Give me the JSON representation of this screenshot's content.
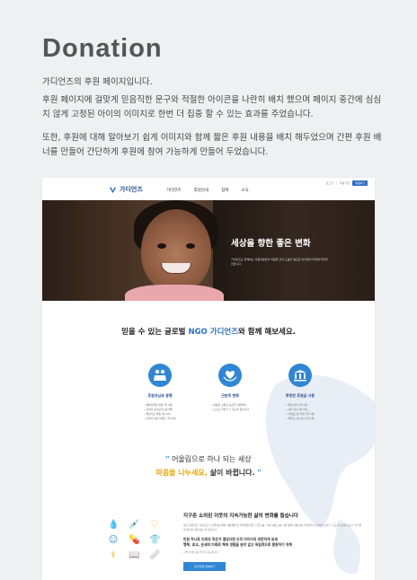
{
  "doc": {
    "title": "Donation",
    "subtitle": "가디언즈의 후원 페이지입니다.",
    "paragraph1": "후원 페이지에 걸맞게 믿음직한 문구와 적절한 아이콘을 나란히 배치 했으며 페이지 중간에 심심치 않게 고정된 아이의 이미지로 한번 더 집중 할 수 있는 효과를 주었습니다.",
    "paragraph2": "또한, 후원에 대해 알아보기 쉽게 이미지와 함께 짧은 후원 내용을 배치 해두었으며 간편 후원 배너를 만들어 간단하게 후원에 참여 가능하게 만들어 두었습니다."
  },
  "site": {
    "util_links": [
      "로그인",
      "회원가입"
    ],
    "donate_button": "후원하기",
    "logo_text": "가디언즈",
    "nav": [
      "가디언즈",
      "후원안내",
      "참여",
      "소식"
    ],
    "hero": {
      "title": "세상을 향한 좋은 변화",
      "text": "가디언즈는 함께하는 후원자분들의 마음을 모아 도움이 필요한 아이들의 미래에 희망을 전합니다."
    },
    "headline_pre": "믿을 수 있는 글로벌 ",
    "headline_accent": "NGO 가디언즈",
    "headline_post": "와 함께 해보세요.",
    "pillars": [
      {
        "icon": "people-icon",
        "glyph": "👥",
        "title": "후원자님과 동행",
        "items": [
          "• 해외사업장 방문 (연 1회)",
          "• 후원자 정기모임 (분기별)",
          "• 해당자료 발송 (월 1회)",
          "• 후원자 참여 이벤트 (연 2회)"
        ]
      },
      {
        "icon": "heart-hands-icon",
        "glyph": "♥",
        "title": "근본적 변화",
        "items": [
          "• 아동의 교육과 보건을 지원하여",
          "• 스스로 자립할 수 있도록 돕습니다"
        ]
      },
      {
        "icon": "bank-icon",
        "glyph": "🏛",
        "title": "투명한 후원금 사용",
        "items": [
          "• 외부 감사 (연 1회)",
          "• 내부 감사 (월 1회)",
          "• 사업보고서 발간 (연 1회)",
          "• 재무보고서 공시 (연 1회)"
        ]
      }
    ],
    "quote_line1": "어울림으로 하나 되는 세상",
    "quote_highlight": "마음을 나누세요,",
    "quote_line2_post": " 삶이 바뀝니다.",
    "mini_icons": [
      "water-drop-icon",
      "syringe-icon",
      "heart-icon",
      "baby-icon",
      "pill-icon",
      "shirt-icon",
      "medicine-icon",
      "book-icon",
      "bandage-icon"
    ],
    "mini_glyphs": [
      "💧",
      "💉",
      "♡",
      "☺",
      "💊",
      "👕",
      "⚕",
      "📖",
      "🩹"
    ],
    "info": {
      "title": "지구촌 소외된 이웃의 지속가능한 삶의 변화를 돕습니다",
      "body": "정기 후원금은 가디언즈가 진행하는 해외 아동결연 및 지역개발사업, 긴급구호, 국내 아동 보호 사업 등에 사용되며, 아이들이 건강하게 자랄 수 있도록 교육과 보건, 식수위생 환경을 개선하는 데 쓰입니다.",
      "emph1": "만원 하나로 미로의 작은가 열었다면 오히 아이가의 대한하게 되세",
      "emph2": "행복, 효교, 온세의 미래로 해에 생활을 분이 없고 독립적으로 활동하기 위해",
      "note": "기부금 영수증 발급이 가능합니다.",
      "button": "정기후원 참여하기"
    }
  }
}
